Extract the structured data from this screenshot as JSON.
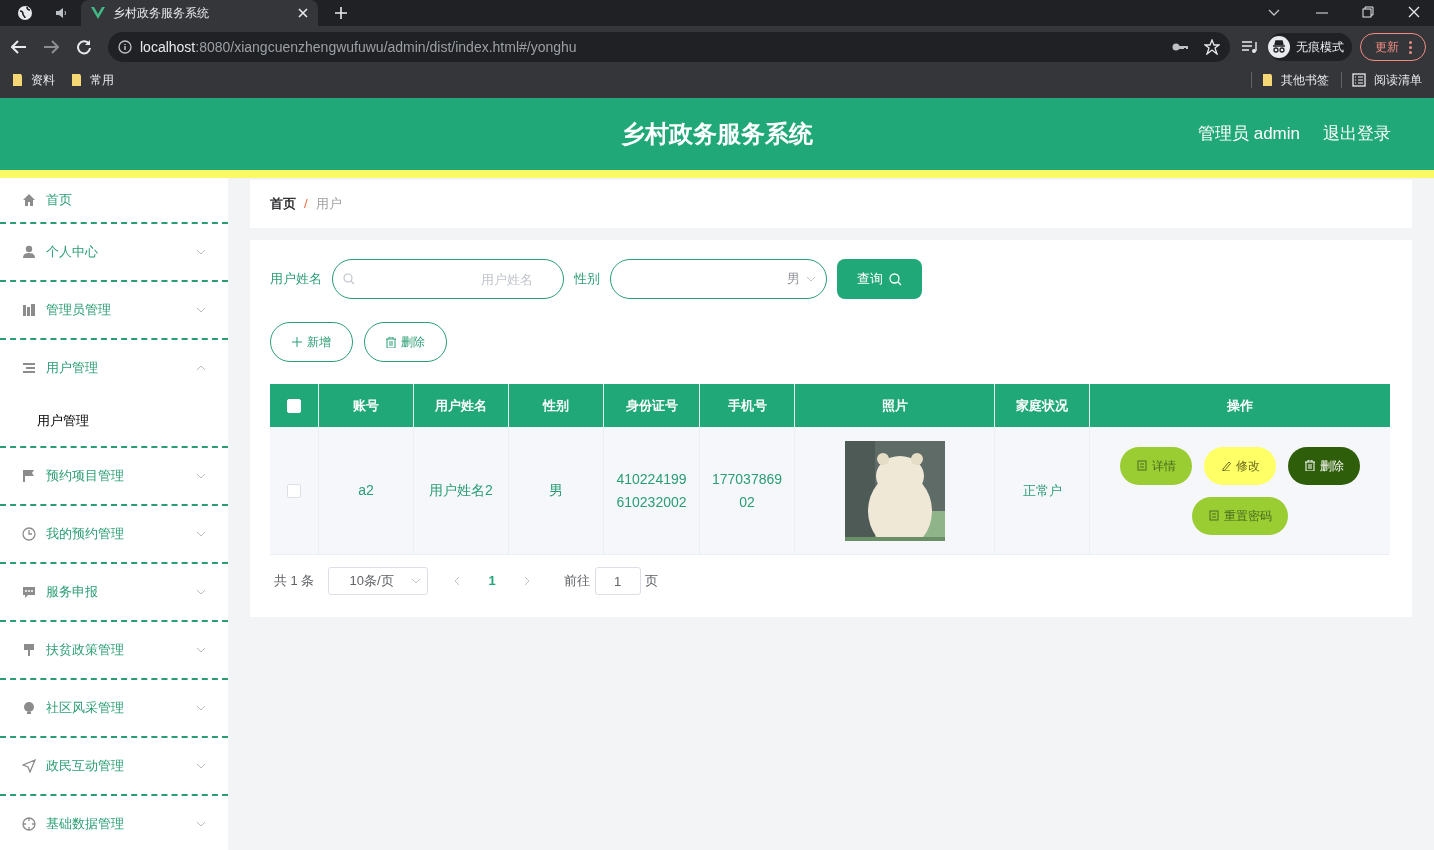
{
  "browser": {
    "tabs": [
      {
        "title": "乡村政务服务系统",
        "selected": true
      }
    ],
    "url": {
      "host": "localhost",
      "path": ":8080/xiangcuenzhengwufuwu/admin/dist/index.html#/yonghu"
    },
    "profile": "无痕模式",
    "update_button": "更新",
    "bookmarks": [
      "资料",
      "常用"
    ],
    "right_bookmarks": [
      {
        "label": "其他书签",
        "kind": "folder"
      },
      {
        "label": "阅读清单",
        "kind": "list"
      }
    ]
  },
  "header": {
    "title": "乡村政务服务系统",
    "user": "管理员 admin",
    "logout": "退出登录"
  },
  "sidebar": {
    "items": [
      {
        "label": "首页",
        "kind": "link"
      },
      {
        "label": "个人中心",
        "kind": "menu",
        "expanded": false
      },
      {
        "label": "管理员管理",
        "kind": "menu",
        "expanded": false
      },
      {
        "label": "用户管理",
        "kind": "menu",
        "expanded": true,
        "children": [
          {
            "label": "用户管理",
            "selected": true
          }
        ]
      },
      {
        "label": "预约项目管理",
        "kind": "menu",
        "expanded": false
      },
      {
        "label": "我的预约管理",
        "kind": "menu",
        "expanded": false
      },
      {
        "label": "服务申报",
        "kind": "menu",
        "expanded": false
      },
      {
        "label": "扶贫政策管理",
        "kind": "menu",
        "expanded": false
      },
      {
        "label": "社区风采管理",
        "kind": "menu",
        "expanded": false
      },
      {
        "label": "政民互动管理",
        "kind": "menu",
        "expanded": false
      },
      {
        "label": "基础数据管理",
        "kind": "menu",
        "expanded": false
      }
    ]
  },
  "breadcrumb": {
    "items": [
      "首页",
      "用户"
    ],
    "separator": "/"
  },
  "search": {
    "fields": [
      {
        "label": "用户姓名",
        "kind": "text",
        "placeholder": "用户姓名"
      },
      {
        "label": "性别",
        "kind": "select",
        "value": "男"
      }
    ],
    "button": "查询"
  },
  "actions": [
    {
      "label": "新增",
      "kind": "add"
    },
    {
      "label": "删除",
      "kind": "delete"
    }
  ],
  "table": {
    "select_all": {
      "checked": false
    },
    "columns": [
      "账号",
      "用户姓名",
      "性别",
      "身份证号",
      "手机号",
      "照片",
      "家庭状况",
      "操作"
    ],
    "rows": [
      {
        "checked": false,
        "account": "a2",
        "name": "用户姓名2",
        "gender": "男",
        "id_number": "410224199610232002",
        "phone": "17703786902",
        "family": "正常户",
        "actions": [
          {
            "label": "详情",
            "kind": "detail"
          },
          {
            "label": "修改",
            "kind": "edit"
          },
          {
            "label": "删除",
            "kind": "delete"
          },
          {
            "label": "重置密码",
            "kind": "reset"
          }
        ]
      }
    ]
  },
  "pagination": {
    "total": "共 1 条",
    "page_size": "10条/页",
    "pages": [
      {
        "label": "1",
        "selected": true
      }
    ],
    "goto_label": "前往",
    "goto_value": "1",
    "page_suffix": "页"
  }
}
